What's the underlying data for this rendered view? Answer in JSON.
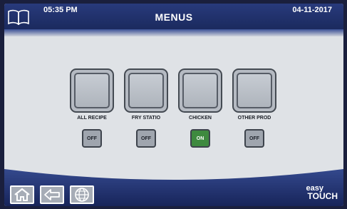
{
  "header": {
    "time": "05:35 PM",
    "title": "MENUS",
    "date": "04-11-2017",
    "book_icon": "open-book-icon"
  },
  "menus": [
    {
      "label": "ALL RECIPE",
      "toggle": "OFF",
      "state": "off"
    },
    {
      "label": "FRY STATIO",
      "toggle": "OFF",
      "state": "off"
    },
    {
      "label": "CHICKEN",
      "toggle": "ON",
      "state": "on"
    },
    {
      "label": "OTHER PROD",
      "toggle": "OFF",
      "state": "off"
    }
  ],
  "footer": {
    "home_icon": "home-icon",
    "back_icon": "back-arrow-icon",
    "globe_icon": "globe-icon",
    "logo_line1": "easy",
    "logo_line2": "TOUCH"
  },
  "colors": {
    "header_blue": "#1b2a5e",
    "on_green": "#3e8a3f",
    "off_gray": "#9fa5ae",
    "screen_bg": "#dfe2e6"
  }
}
